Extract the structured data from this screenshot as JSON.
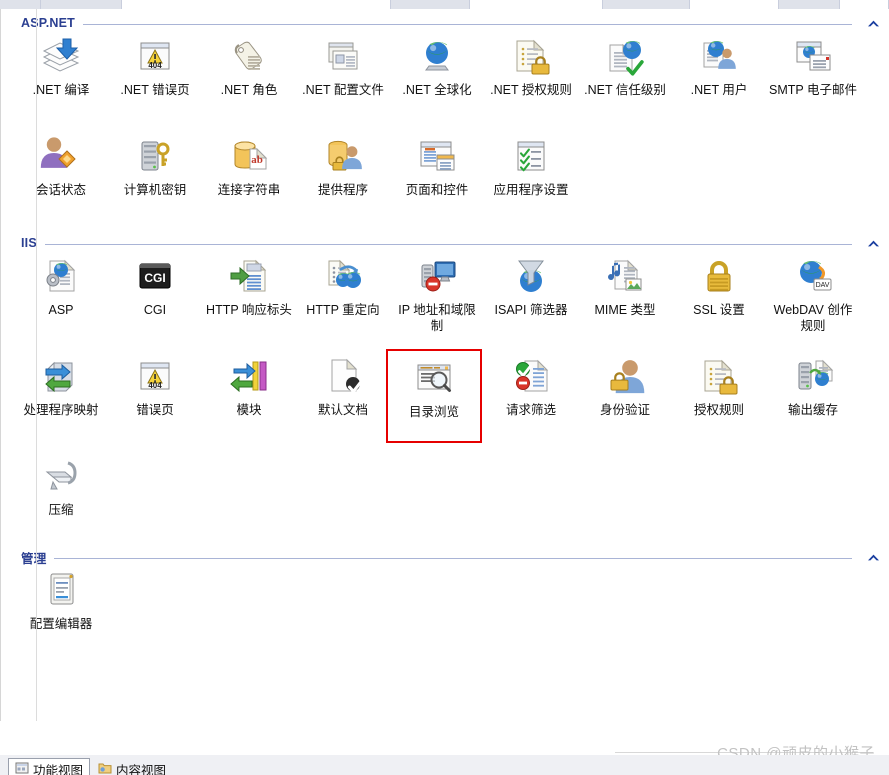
{
  "window": {
    "pane_background": "#ffffff",
    "accent_header_color": "#2b3f91",
    "selection_color": "#e60000"
  },
  "sections": [
    {
      "id": "aspnet",
      "title": "ASP.NET",
      "collapse_icon": "chevron-up-icon",
      "items": [
        {
          "label": ".NET 编译",
          "icon": "net-compilation-icon"
        },
        {
          "label": ".NET 错误页",
          "icon": "net-error-pages-icon"
        },
        {
          "label": ".NET 角色",
          "icon": "net-roles-icon"
        },
        {
          "label": ".NET 配置文件",
          "icon": "net-profile-icon"
        },
        {
          "label": ".NET 全球化",
          "icon": "net-globalization-icon"
        },
        {
          "label": ".NET 授权规则",
          "icon": "net-authorization-rules-icon"
        },
        {
          "label": ".NET 信任级别",
          "icon": "net-trust-levels-icon"
        },
        {
          "label": ".NET 用户",
          "icon": "net-users-icon"
        },
        {
          "label": "SMTP 电子邮件",
          "icon": "smtp-email-icon"
        },
        {
          "label": "会话状态",
          "icon": "session-state-icon"
        },
        {
          "label": "计算机密钥",
          "icon": "machine-key-icon"
        },
        {
          "label": "连接字符串",
          "icon": "connection-strings-icon"
        },
        {
          "label": "提供程序",
          "icon": "providers-icon"
        },
        {
          "label": "页面和控件",
          "icon": "pages-and-controls-icon"
        },
        {
          "label": "应用程序设置",
          "icon": "application-settings-icon"
        }
      ]
    },
    {
      "id": "iis",
      "title": "IIS",
      "collapse_icon": "chevron-up-icon",
      "items": [
        {
          "label": "ASP",
          "icon": "asp-icon"
        },
        {
          "label": "CGI",
          "icon": "cgi-icon"
        },
        {
          "label": "HTTP 响应标头",
          "icon": "http-response-headers-icon"
        },
        {
          "label": "HTTP 重定向",
          "icon": "http-redirect-icon"
        },
        {
          "label": "IP 地址和域限制",
          "icon": "ip-address-domain-restrictions-icon"
        },
        {
          "label": "ISAPI 筛选器",
          "icon": "isapi-filters-icon"
        },
        {
          "label": "MIME 类型",
          "icon": "mime-types-icon"
        },
        {
          "label": "SSL 设置",
          "icon": "ssl-settings-icon"
        },
        {
          "label": "WebDAV 创作规则",
          "icon": "webdav-authoring-rules-icon"
        },
        {
          "label": "处理程序映射",
          "icon": "handler-mappings-icon"
        },
        {
          "label": "错误页",
          "icon": "error-pages-icon"
        },
        {
          "label": "模块",
          "icon": "modules-icon"
        },
        {
          "label": "默认文档",
          "icon": "default-document-icon"
        },
        {
          "label": "目录浏览",
          "icon": "directory-browsing-icon",
          "selected": true
        },
        {
          "label": "请求筛选",
          "icon": "request-filtering-icon"
        },
        {
          "label": "身份验证",
          "icon": "authentication-icon"
        },
        {
          "label": "授权规则",
          "icon": "authorization-rules-icon"
        },
        {
          "label": "输出缓存",
          "icon": "output-caching-icon"
        },
        {
          "label": "压缩",
          "icon": "compression-icon"
        }
      ]
    },
    {
      "id": "management",
      "title": "管理",
      "collapse_icon": "chevron-up-icon",
      "items": [
        {
          "label": "配置编辑器",
          "icon": "configuration-editor-icon"
        }
      ]
    }
  ],
  "view_tabs": [
    {
      "label": "功能视图",
      "icon": "features-view-icon",
      "active": true
    },
    {
      "label": "内容视图",
      "icon": "content-view-icon",
      "active": false
    }
  ],
  "watermark": {
    "text": "CSDN @顽皮的小猴子"
  }
}
